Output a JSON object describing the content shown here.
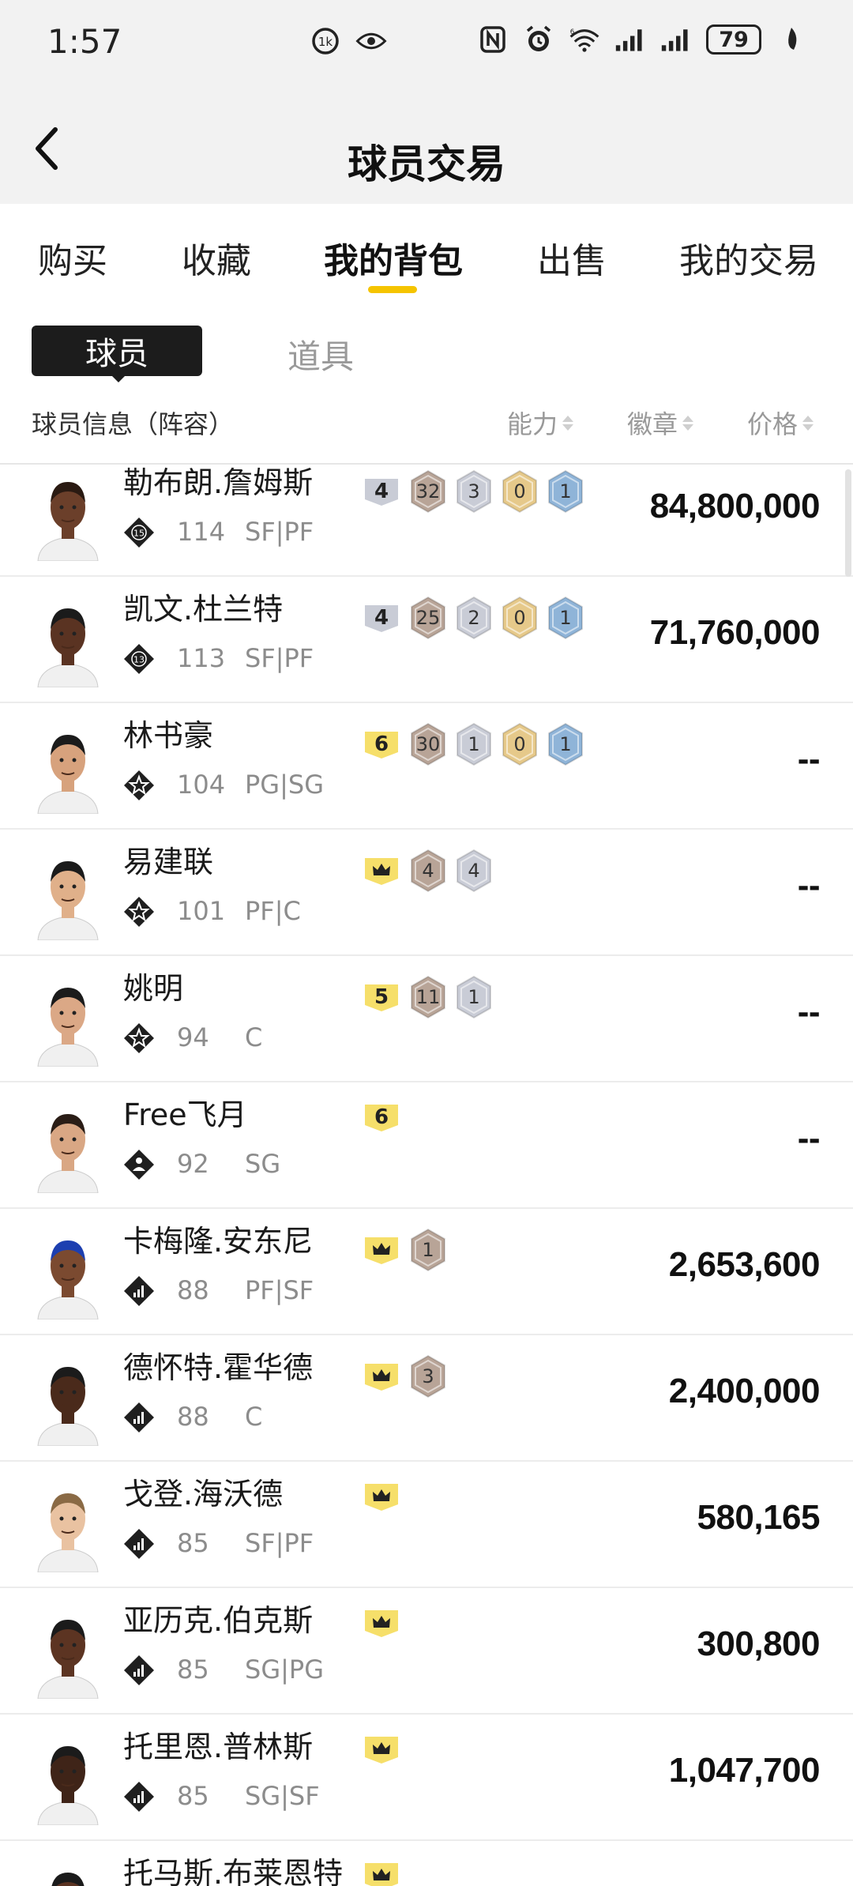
{
  "status_bar": {
    "time": "1:57",
    "battery": "79",
    "icons": [
      "nfc-icon",
      "alarm-icon",
      "wifi-icon",
      "signal-icon",
      "signal-icon",
      "battery-icon"
    ]
  },
  "header": {
    "title": "球员交易",
    "back_icon": "chevron-left-icon"
  },
  "tabs": [
    {
      "label": "购买",
      "active": false
    },
    {
      "label": "收藏",
      "active": false
    },
    {
      "label": "我的背包",
      "active": true
    },
    {
      "label": "出售",
      "active": false
    },
    {
      "label": "我的交易",
      "active": false
    }
  ],
  "segments": {
    "players": "球员",
    "items": "道具"
  },
  "columns": {
    "info": "球员信息（阵容）",
    "ability": "能力",
    "badges": "徽章",
    "price": "价格"
  },
  "colors": {
    "accent": "#f5c400",
    "bronze": "#b8a497",
    "silver": "#c9ccd6",
    "gold": "#e6c98a",
    "hof": "#8fb4d8",
    "level_yellow": "#f6df6a"
  },
  "players": [
    {
      "name": "勒布朗.詹姆斯",
      "tier": "15",
      "rating": "114",
      "pos": "SF|PF",
      "level": "4",
      "level_type": "grey",
      "badges": [
        "32",
        "3",
        "0",
        "1"
      ],
      "price": "84,800,000"
    },
    {
      "name": "凯文.杜兰特",
      "tier": "13",
      "rating": "113",
      "pos": "SF|PF",
      "level": "4",
      "level_type": "grey",
      "badges": [
        "25",
        "2",
        "0",
        "1"
      ],
      "price": "71,760,000"
    },
    {
      "name": "林书豪",
      "tier": "star",
      "rating": "104",
      "pos": "PG|SG",
      "level": "6",
      "level_type": "yellow",
      "badges": [
        "30",
        "1",
        "0",
        "1"
      ],
      "price": "--"
    },
    {
      "name": "易建联",
      "tier": "star",
      "rating": "101",
      "pos": "PF|C",
      "level": "crown",
      "level_type": "yellow",
      "badges": [
        "4",
        "4"
      ],
      "price": "--"
    },
    {
      "name": "姚明",
      "tier": "star",
      "rating": "94",
      "pos": "C",
      "level": "5",
      "level_type": "yellow",
      "badges": [
        "11",
        "1"
      ],
      "price": "--"
    },
    {
      "name": "Free飞月",
      "tier": "person",
      "rating": "92",
      "pos": "SG",
      "level": "6",
      "level_type": "yellow",
      "badges": [],
      "price": "--"
    },
    {
      "name": "卡梅隆.安东尼",
      "tier": "bars",
      "rating": "88",
      "pos": "PF|SF",
      "level": "crown",
      "level_type": "yellow",
      "badges": [
        "1"
      ],
      "price": "2,653,600"
    },
    {
      "name": "德怀特.霍华德",
      "tier": "bars",
      "rating": "88",
      "pos": "C",
      "level": "crown",
      "level_type": "yellow",
      "badges": [
        "3"
      ],
      "price": "2,400,000"
    },
    {
      "name": "戈登.海沃德",
      "tier": "bars",
      "rating": "85",
      "pos": "SF|PF",
      "level": "crown",
      "level_type": "yellow",
      "badges": [],
      "price": "580,165"
    },
    {
      "name": "亚历克.伯克斯",
      "tier": "bars",
      "rating": "85",
      "pos": "SG|PG",
      "level": "crown",
      "level_type": "yellow",
      "badges": [],
      "price": "300,800"
    },
    {
      "name": "托里恩.普林斯",
      "tier": "bars",
      "rating": "85",
      "pos": "SG|SF",
      "level": "crown",
      "level_type": "yellow",
      "badges": [],
      "price": "1,047,700"
    },
    {
      "name": "托马斯.布莱恩特",
      "tier": "bars",
      "rating": "",
      "pos": "",
      "level": "crown",
      "level_type": "yellow",
      "badges": [],
      "price": ""
    }
  ]
}
